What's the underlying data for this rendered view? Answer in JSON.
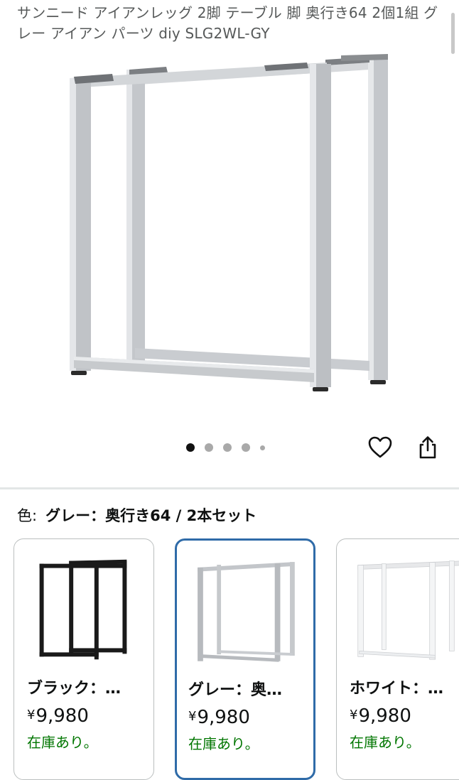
{
  "product": {
    "title": "サンニード アイアンレッグ 2脚 テーブル 脚 奥行き64 2個1組 グレー アイアン パーツ diy SLG2WL-GY"
  },
  "gallery": {
    "image_count": 5,
    "active_index": 0,
    "favorite_icon": "heart-icon",
    "share_icon": "share-icon"
  },
  "variation": {
    "label": "色:",
    "selected_value": "グレー：奥行き64 / 2本セット",
    "options": [
      {
        "name": "ブラック：…",
        "currency": "¥",
        "price": "9,980",
        "stock": "在庫あり。",
        "color": "#1a1a1a"
      },
      {
        "name": "グレー：奥…",
        "currency": "¥",
        "price": "9,980",
        "stock": "在庫あり。",
        "color": "#b9bcc0"
      },
      {
        "name": "ホワイト：…",
        "currency": "¥",
        "price": "9,980",
        "stock": "在庫あり。",
        "color": "#f2f2f2"
      }
    ]
  },
  "colors": {
    "selected_border": "#2f6ba8",
    "stock_green": "#007600"
  }
}
